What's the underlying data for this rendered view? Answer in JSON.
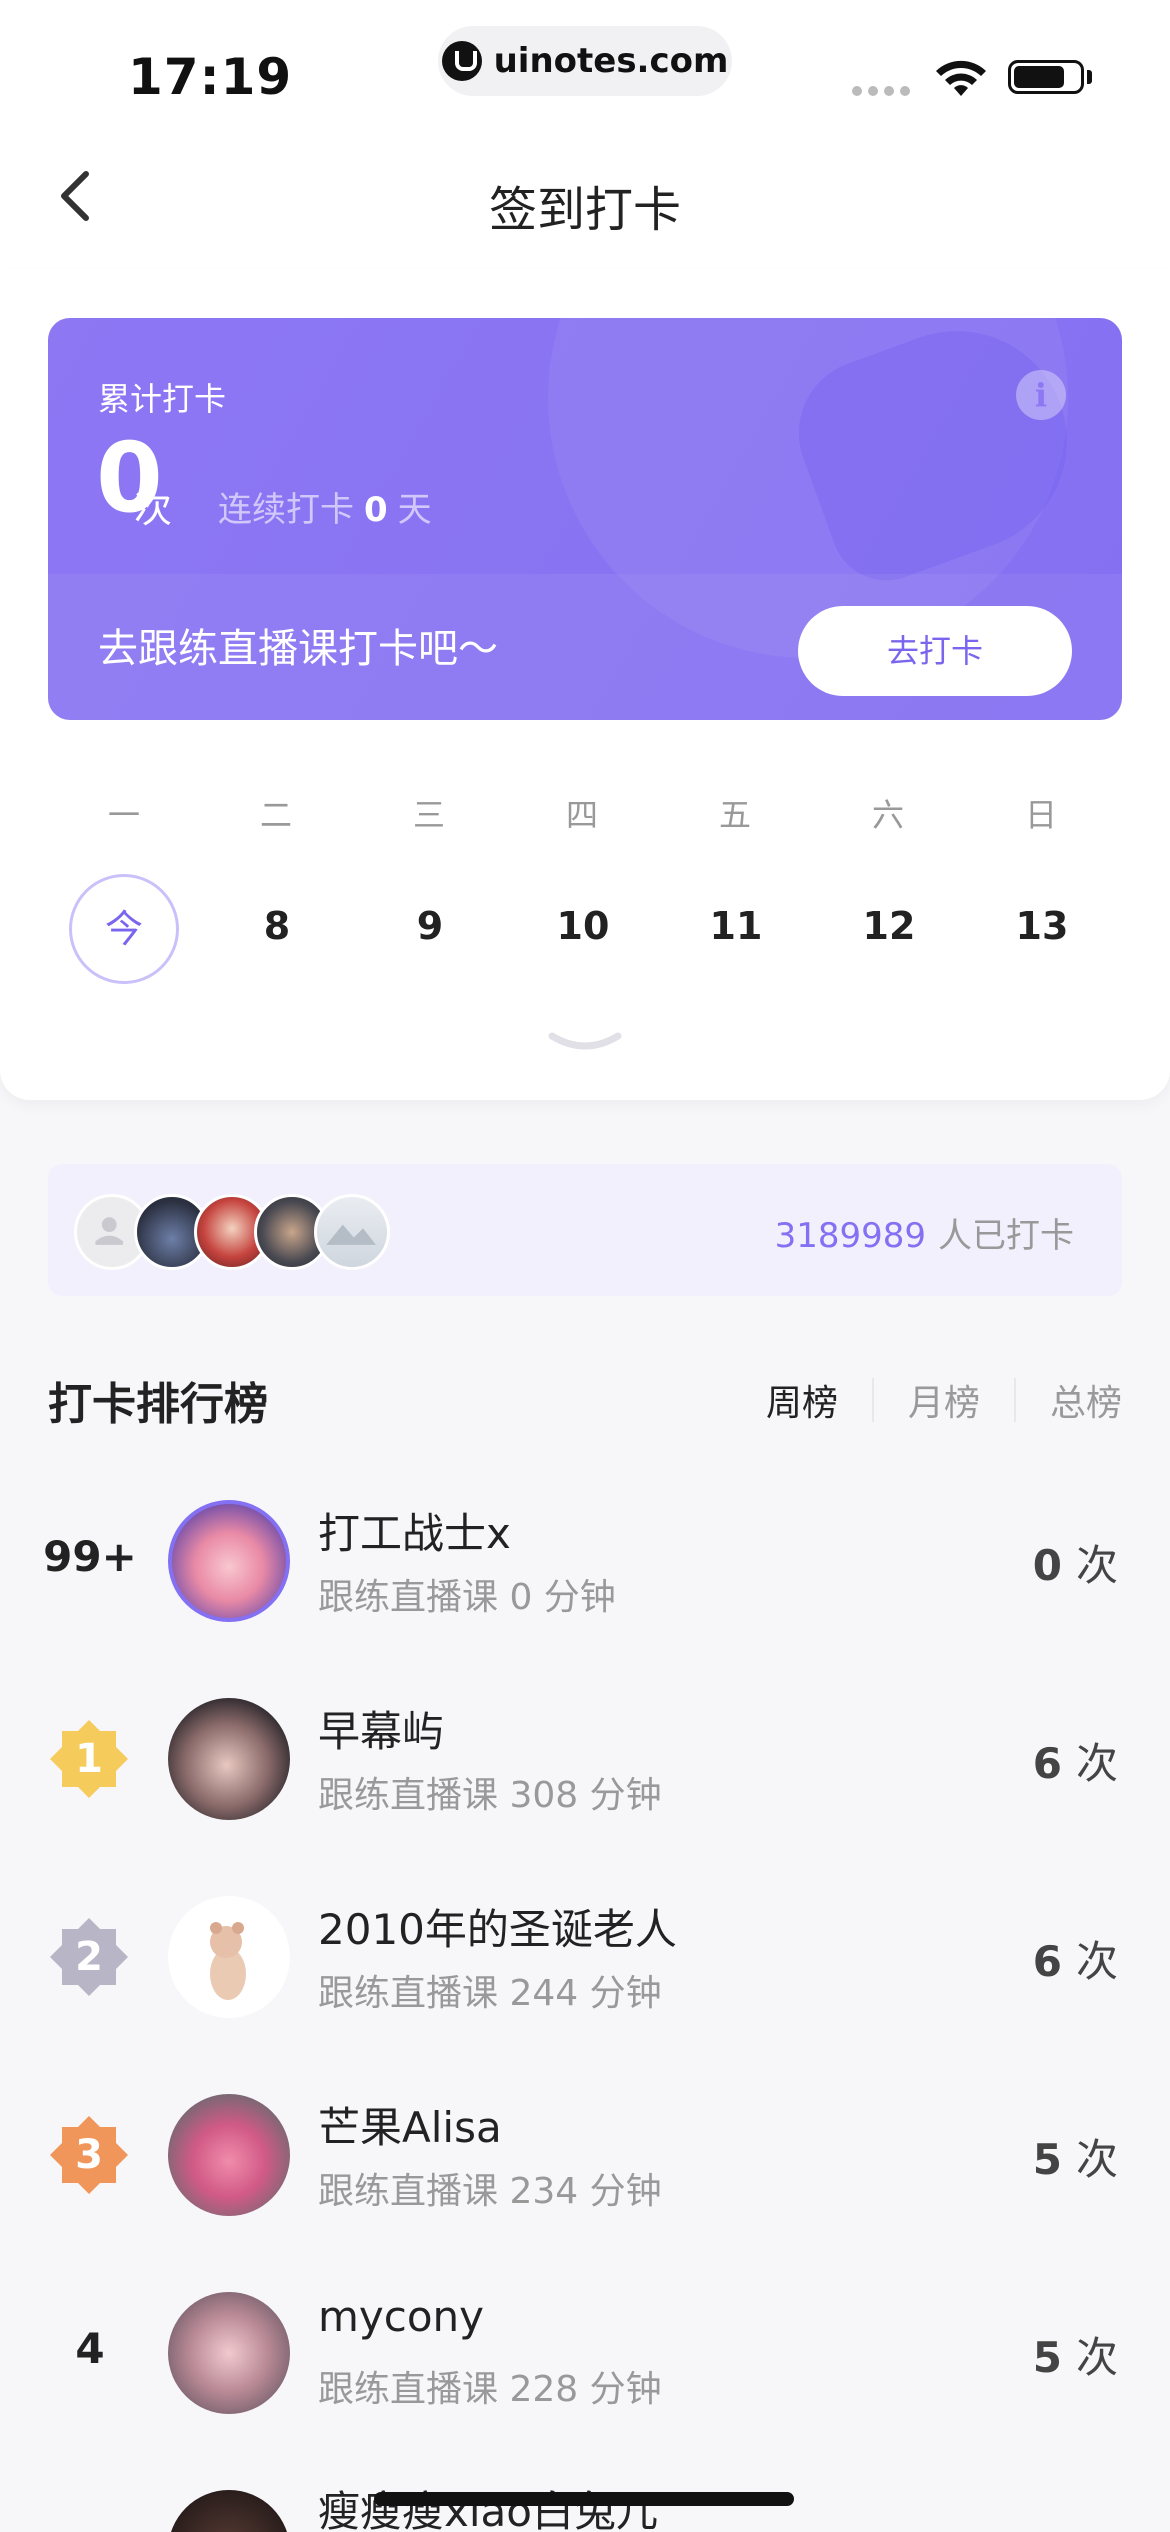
{
  "status_bar": {
    "time": "17:19",
    "url": "uinotes.com"
  },
  "nav": {
    "title": "签到打卡"
  },
  "card": {
    "label": "累计打卡",
    "count": "0",
    "count_unit": "次",
    "streak_prefix": "连续打卡",
    "streak_value": "0",
    "streak_suffix": "天",
    "prompt": "去跟练直播课打卡吧～",
    "button": "去打卡"
  },
  "week": {
    "days": [
      "一",
      "二",
      "三",
      "四",
      "五",
      "六",
      "日"
    ],
    "dates": [
      "今",
      "8",
      "9",
      "10",
      "11",
      "12",
      "13"
    ]
  },
  "participants": {
    "count": "3189989",
    "suffix": "人已打卡"
  },
  "leaderboard": {
    "title": "打卡排行榜",
    "tabs": [
      "周榜",
      "月榜",
      "总榜"
    ],
    "rows": [
      {
        "rank": "99+",
        "name": "打工战士x",
        "sub": "跟练直播课 0 分钟",
        "count": "0",
        "unit": "次"
      },
      {
        "rank": "1",
        "name": "早幕屿",
        "sub": "跟练直播课 308 分钟",
        "count": "6",
        "unit": "次"
      },
      {
        "rank": "2",
        "name": "2010年的圣诞老人",
        "sub": "跟练直播课 244 分钟",
        "count": "6",
        "unit": "次"
      },
      {
        "rank": "3",
        "name": "芒果Alisa",
        "sub": "跟练直播课 234 分钟",
        "count": "5",
        "unit": "次"
      },
      {
        "rank": "4",
        "name": "mycony",
        "sub": "跟练直播课 228 分钟",
        "count": "5",
        "unit": "次"
      },
      {
        "rank": "",
        "name": "瘦瘦瘦xiao白兔儿",
        "sub": "",
        "count": "",
        "unit": ""
      }
    ]
  },
  "colors": {
    "accent": "#8470f2",
    "gold": "#f5cc5c",
    "silver": "#b8b5c6",
    "bronze": "#f0965a"
  }
}
